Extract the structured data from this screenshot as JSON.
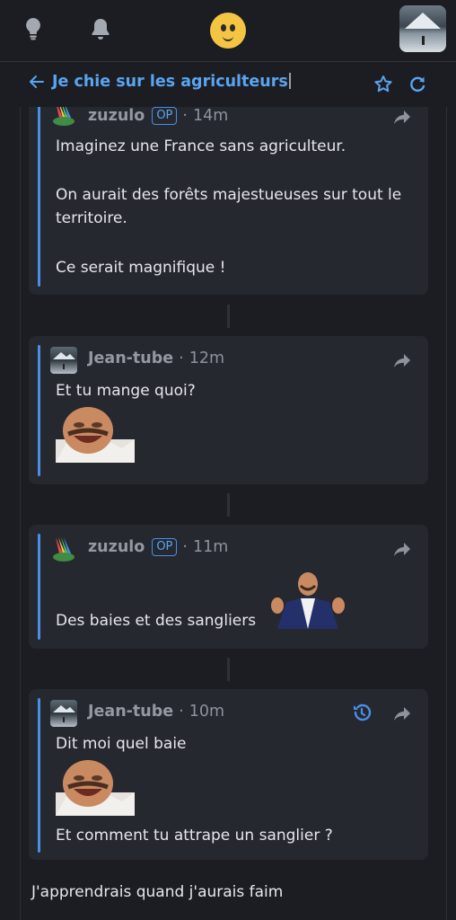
{
  "topbar": {
    "icons": [
      "lightbulb-icon",
      "bell-icon",
      "emoji-face-icon",
      "user-avatar"
    ]
  },
  "header": {
    "title": "Je chie sur les agriculteurs",
    "icons": [
      "back-arrow-icon",
      "star-icon",
      "refresh-icon"
    ]
  },
  "comments": [
    {
      "author": "zuzulo",
      "op_badge": "OP",
      "time": "14m",
      "lines": [
        "Imaginez une France sans agriculteur.",
        "On aurait des forêts majestueuses sur tout le",
        "territoire.",
        "Ce serait magnifique !"
      ]
    },
    {
      "author": "Jean-tube",
      "time": "12m",
      "lines": [
        "Et tu mange quoi?"
      ]
    },
    {
      "author": "zuzulo",
      "op_badge": "OP",
      "time": "11m",
      "lines": [
        "Des baies et des sangliers"
      ]
    },
    {
      "author": "Jean-tube",
      "time": "10m",
      "lines": [
        "Dit moi quel baie",
        "Et comment tu attrape un sanglier ?"
      ]
    }
  ],
  "footer": {
    "text": "J'apprendrais quand j'aurais faim"
  },
  "colors": {
    "accent": "#5aa4f0",
    "background": "#1c1d23",
    "card": "#26282f"
  }
}
